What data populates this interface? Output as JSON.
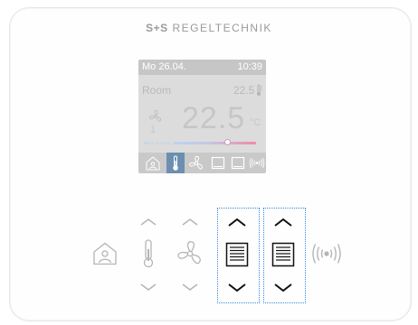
{
  "brand": {
    "part1": "S+S",
    "part2": " REGELTECHNIK"
  },
  "display": {
    "date": "Mo 26.04.",
    "time": "10:39",
    "room_label": "Room",
    "room_value": "22.5",
    "setpoint": "22.5",
    "unit": "°C",
    "fan_level": "1",
    "setpoint_level": 0.66,
    "menu_icons": [
      "home-icon",
      "thermometer-icon",
      "fan-icon",
      "screen-icon",
      "screen-icon",
      "wireless-icon"
    ],
    "selected_menu": "thermometer-icon"
  },
  "colors": {
    "lcd_background": "#dcdcdc",
    "lcd_text": "#c6c6c6",
    "selected_tab": "#6c8fb0",
    "selection_outline": "#3a8ad8",
    "icon_gray": "#b5b5b5"
  },
  "buttons": [
    {
      "name": "home-button",
      "icon": "home-icon"
    },
    {
      "name": "temperature-button",
      "icon": "thermometer-icon"
    },
    {
      "name": "fan-button",
      "icon": "fan-icon"
    },
    {
      "name": "blind-1-button",
      "icon": "blind-icon",
      "highlighted": true
    },
    {
      "name": "blind-2-button",
      "icon": "blind-icon",
      "highlighted": true
    },
    {
      "name": "wireless-button",
      "icon": "wireless-icon"
    }
  ]
}
